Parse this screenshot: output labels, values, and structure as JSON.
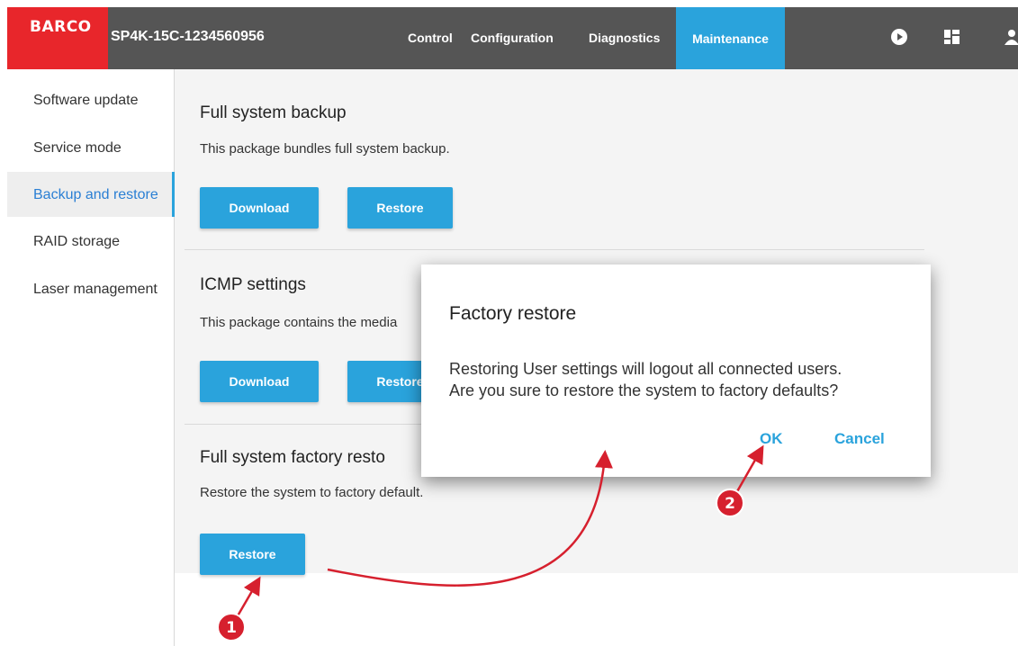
{
  "header": {
    "logo": "BARCO",
    "device_name": "SP4K-15C-1234560956",
    "tabs": [
      {
        "label": "Control"
      },
      {
        "label": "Configuration"
      },
      {
        "label": "Diagnostics"
      },
      {
        "label": "Maintenance",
        "active": true
      }
    ],
    "icons": [
      "play-icon",
      "dashboard-icon",
      "user-icon"
    ]
  },
  "sidebar": {
    "items": [
      {
        "label": "Software update"
      },
      {
        "label": "Service mode"
      },
      {
        "label": "Backup and restore",
        "active": true
      },
      {
        "label": "RAID storage"
      },
      {
        "label": "Laser management"
      }
    ]
  },
  "sections": [
    {
      "title": "Full system backup",
      "description": "This package bundles full system backup.",
      "buttons": [
        "Download",
        "Restore"
      ]
    },
    {
      "title": "ICMP settings",
      "description": "This package contains the media",
      "buttons": [
        "Download",
        "Restore"
      ]
    },
    {
      "title": "Full system factory resto",
      "description": "Restore the system to factory default.",
      "buttons": [
        "Restore"
      ]
    }
  ],
  "dialog": {
    "title": "Factory restore",
    "message_line1": "Restoring User settings will logout all connected users.",
    "message_line2": "Are you sure to restore the system to factory defaults?",
    "ok_label": "OK",
    "cancel_label": "Cancel"
  },
  "annotations": {
    "step1": "1",
    "step2": "2"
  },
  "colors": {
    "accent": "#2aa3dc",
    "brand_red": "#e8262b",
    "header_bg": "#555555",
    "annotation_red": "#d6202e"
  }
}
